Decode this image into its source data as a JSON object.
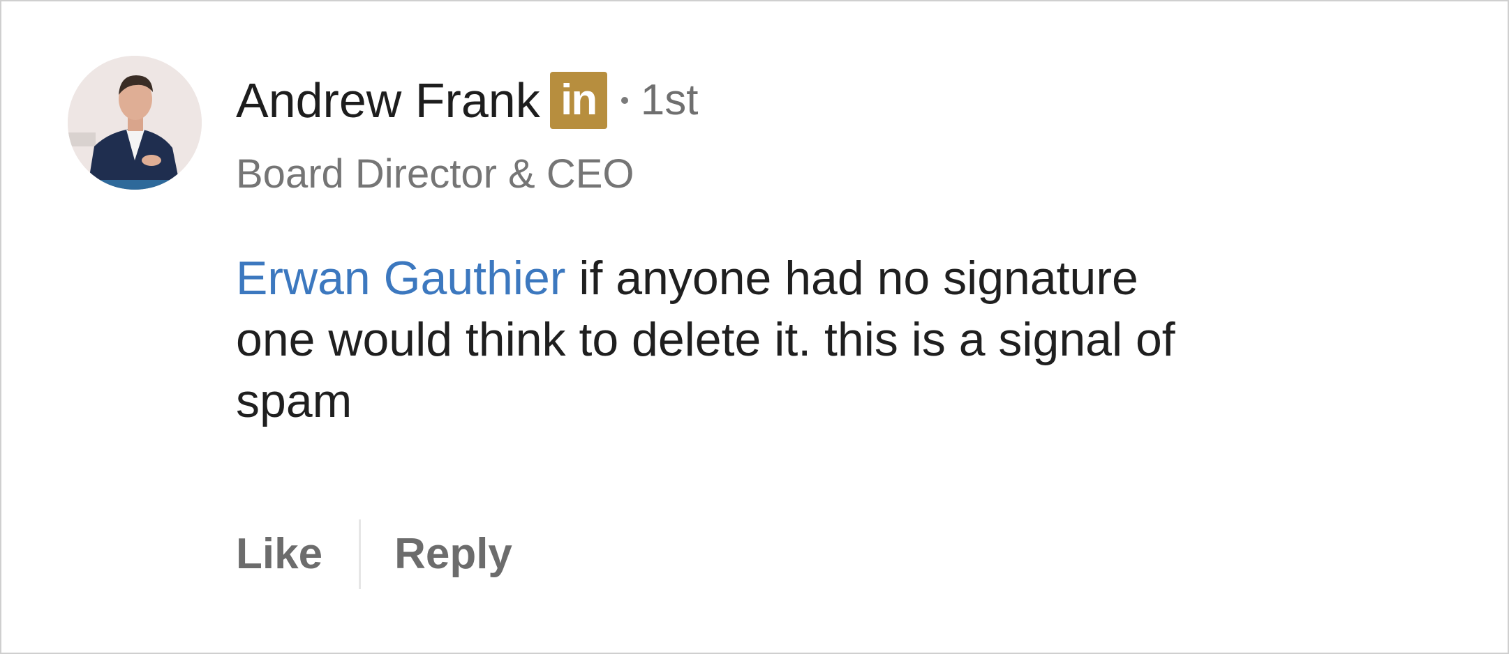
{
  "comment": {
    "author": {
      "name": "Andrew Frank",
      "badge_label": "in",
      "badge_color": "#b78e3e",
      "connection_degree": "1st",
      "headline": "Board Director & CEO",
      "avatar_icon": "profile-photo"
    },
    "mention": "Erwan Gauthier",
    "text_line1": " if anyone had no signature",
    "text_line2": "one would think to delete it. this is a signal of",
    "text_line3": "spam",
    "mention_color": "#3c78bf"
  },
  "actions": {
    "like_label": "Like",
    "reply_label": "Reply"
  }
}
